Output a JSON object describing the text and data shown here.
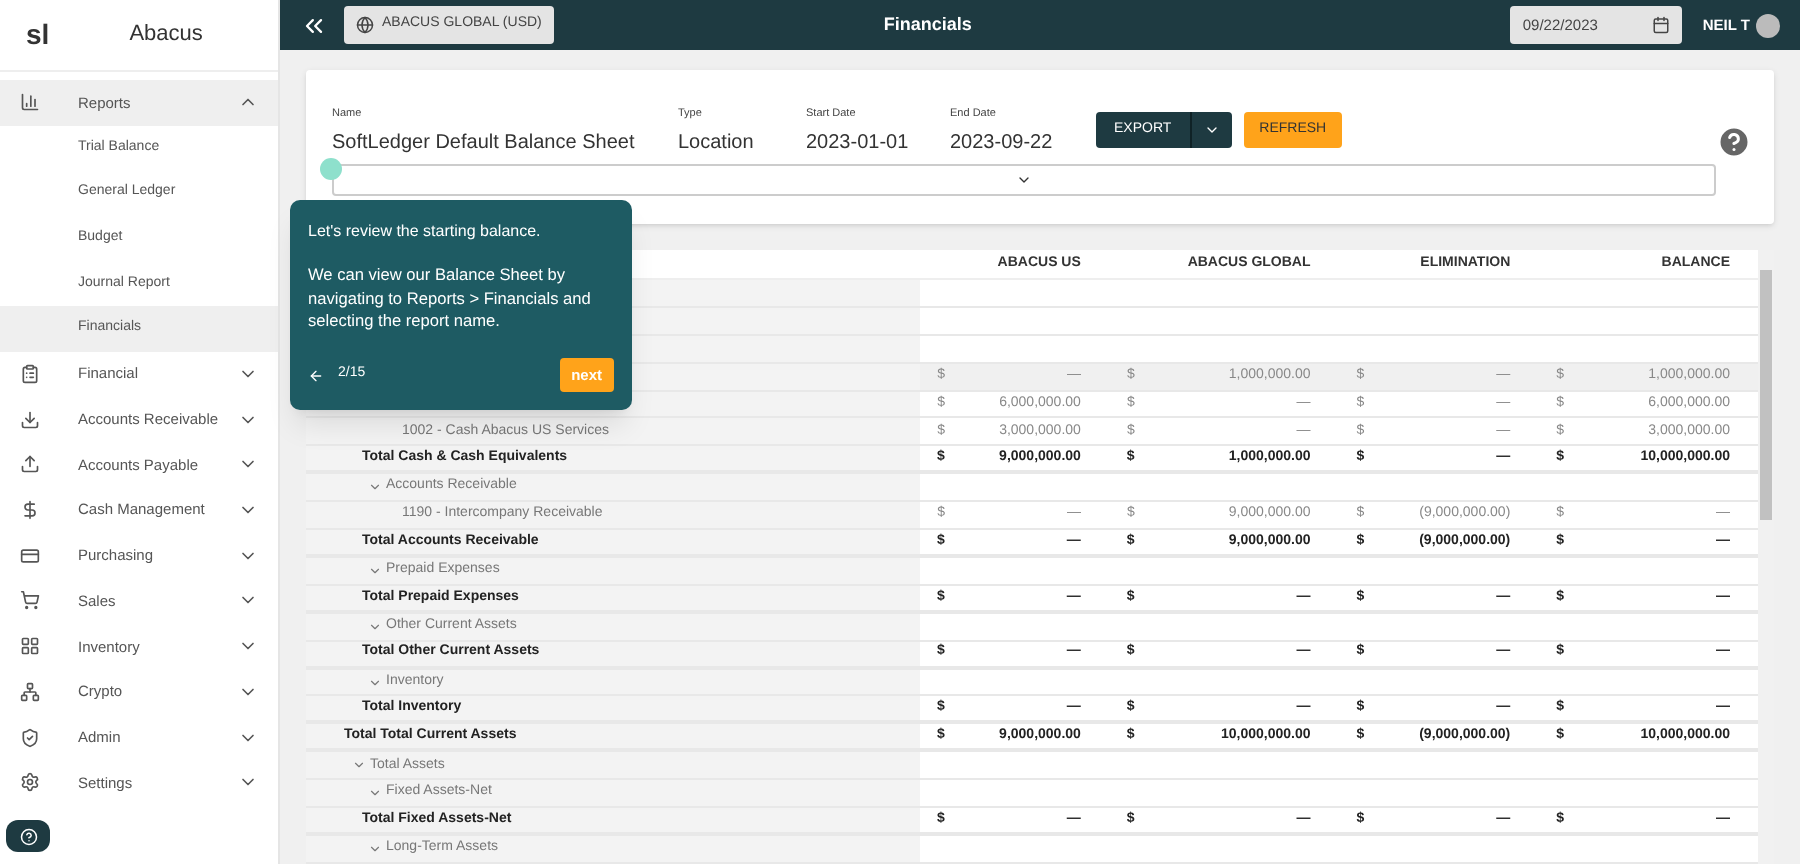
{
  "sidebar": {
    "logo": "sl",
    "org": "Abacus",
    "items": [
      {
        "label": "Reports",
        "expanded": true,
        "children": [
          {
            "label": "Trial Balance",
            "selected": false
          },
          {
            "label": "General Ledger",
            "selected": false
          },
          {
            "label": "Budget",
            "selected": false
          },
          {
            "label": "Journal Report",
            "selected": false
          },
          {
            "label": "Financials",
            "selected": true
          }
        ]
      },
      {
        "label": "Financial",
        "expanded": false
      },
      {
        "label": "Accounts Receivable",
        "expanded": false
      },
      {
        "label": "Accounts Payable",
        "expanded": false
      },
      {
        "label": "Cash Management",
        "expanded": false
      },
      {
        "label": "Purchasing",
        "expanded": false
      },
      {
        "label": "Sales",
        "expanded": false
      },
      {
        "label": "Inventory",
        "expanded": false
      },
      {
        "label": "Crypto",
        "expanded": false
      },
      {
        "label": "Admin",
        "expanded": false
      },
      {
        "label": "Settings",
        "expanded": false
      }
    ]
  },
  "topbar": {
    "entity": "ABACUS GLOBAL (USD)",
    "title": "Financials",
    "date": "09/22/2023",
    "user": "NEIL T"
  },
  "filters": {
    "fields": [
      {
        "label": "Name",
        "value": "SoftLedger Default Balance Sheet"
      },
      {
        "label": "Type",
        "value": "Location"
      },
      {
        "label": "Start Date",
        "value": "2023-01-01"
      },
      {
        "label": "End Date",
        "value": "2023-09-22"
      }
    ],
    "export": "EXPORT",
    "refresh": "REFRESH"
  },
  "tour": {
    "title": "Let's review the starting balance.",
    "body": "We can view our Balance Sheet by navigating to Reports > Financials and selecting the report name.",
    "step": "2/15",
    "next": "next"
  },
  "table": {
    "columns": [
      "ABACUS US",
      "ABACUS GLOBAL",
      "ELIMINATION",
      "BALANCE"
    ],
    "rows": [
      {
        "kind": "group",
        "children": [
          {
            "kind": "group",
            "children": [
              {
                "kind": "group",
                "children": [
                  {
                    "kind": "account",
                    "hovered": true,
                    "values": [
                      {
                        "currency": "$",
                        "amount": "—"
                      },
                      {
                        "currency": "$",
                        "amount": "1,000,000.00"
                      },
                      {
                        "currency": "$",
                        "amount": "—"
                      },
                      {
                        "currency": "$",
                        "amount": "1,000,000.00"
                      }
                    ]
                  },
                  {
                    "kind": "account",
                    "hovered": false,
                    "values": [
                      {
                        "currency": "$",
                        "amount": "6,000,000.00"
                      },
                      {
                        "currency": "$",
                        "amount": "—"
                      },
                      {
                        "currency": "$",
                        "amount": "—"
                      },
                      {
                        "currency": "$",
                        "amount": "6,000,000.00"
                      }
                    ]
                  },
                  {
                    "kind": "account",
                    "hovered": false,
                    "label": "1002 - Cash Abacus US Services",
                    "values": [
                      {
                        "currency": "$",
                        "amount": "3,000,000.00"
                      },
                      {
                        "currency": "$",
                        "amount": "—"
                      },
                      {
                        "currency": "$",
                        "amount": "—"
                      },
                      {
                        "currency": "$",
                        "amount": "3,000,000.00"
                      }
                    ]
                  }
                ]
              },
              {
                "kind": "total",
                "label": "Total Cash & Cash Equivalents",
                "values": [
                  {
                    "currency": "$",
                    "amount": "9,000,000.00"
                  },
                  {
                    "currency": "$",
                    "amount": "1,000,000.00"
                  },
                  {
                    "currency": "$",
                    "amount": "—"
                  },
                  {
                    "currency": "$",
                    "amount": "10,000,000.00"
                  }
                ]
              },
              {
                "kind": "group",
                "label": "Accounts Receivable",
                "expanded": true,
                "children": [
                  {
                    "kind": "account",
                    "hovered": false,
                    "label": "1190 - Intercompany Receivable",
                    "values": [
                      {
                        "currency": "$",
                        "amount": "—"
                      },
                      {
                        "currency": "$",
                        "amount": "9,000,000.00"
                      },
                      {
                        "currency": "$",
                        "amount": "(9,000,000.00)"
                      },
                      {
                        "currency": "$",
                        "amount": "—"
                      }
                    ]
                  }
                ]
              },
              {
                "kind": "total",
                "label": "Total Accounts Receivable",
                "values": [
                  {
                    "currency": "$",
                    "amount": "—"
                  },
                  {
                    "currency": "$",
                    "amount": "9,000,000.00"
                  },
                  {
                    "currency": "$",
                    "amount": "(9,000,000.00)"
                  },
                  {
                    "currency": "$",
                    "amount": "—"
                  }
                ]
              },
              {
                "kind": "group",
                "label": "Prepaid Expenses",
                "expanded": true
              },
              {
                "kind": "total",
                "label": "Total Prepaid Expenses",
                "values": [
                  {
                    "currency": "$",
                    "amount": "—"
                  },
                  {
                    "currency": "$",
                    "amount": "—"
                  },
                  {
                    "currency": "$",
                    "amount": "—"
                  },
                  {
                    "currency": "$",
                    "amount": "—"
                  }
                ]
              },
              {
                "kind": "group",
                "label": "Other Current Assets",
                "expanded": true
              },
              {
                "kind": "total",
                "label": "Total Other Current Assets",
                "values": [
                  {
                    "currency": "$",
                    "amount": "—"
                  },
                  {
                    "currency": "$",
                    "amount": "—"
                  },
                  {
                    "currency": "$",
                    "amount": "—"
                  },
                  {
                    "currency": "$",
                    "amount": "—"
                  }
                ]
              },
              {
                "kind": "group",
                "label": "Inventory",
                "expanded": true
              },
              {
                "kind": "total",
                "label": "Total Inventory",
                "values": [
                  {
                    "currency": "$",
                    "amount": "—"
                  },
                  {
                    "currency": "$",
                    "amount": "—"
                  },
                  {
                    "currency": "$",
                    "amount": "—"
                  },
                  {
                    "currency": "$",
                    "amount": "—"
                  }
                ]
              }
            ]
          },
          {
            "kind": "total",
            "label": "Total Total Current Assets",
            "values": [
              {
                "currency": "$",
                "amount": "9,000,000.00"
              },
              {
                "currency": "$",
                "amount": "10,000,000.00"
              },
              {
                "currency": "$",
                "amount": "(9,000,000.00)"
              },
              {
                "currency": "$",
                "amount": "10,000,000.00"
              }
            ]
          },
          {
            "kind": "group",
            "label": "Total Assets",
            "expanded": true,
            "children": [
              {
                "kind": "group",
                "label": "Fixed Assets-Net",
                "expanded": true
              },
              {
                "kind": "total",
                "label": "Total Fixed Assets-Net",
                "values": [
                  {
                    "currency": "$",
                    "amount": "—"
                  },
                  {
                    "currency": "$",
                    "amount": "—"
                  },
                  {
                    "currency": "$",
                    "amount": "—"
                  },
                  {
                    "currency": "$",
                    "amount": "—"
                  }
                ]
              },
              {
                "kind": "group",
                "label": "Long-Term Assets",
                "expanded": true
              }
            ]
          }
        ]
      }
    ]
  }
}
